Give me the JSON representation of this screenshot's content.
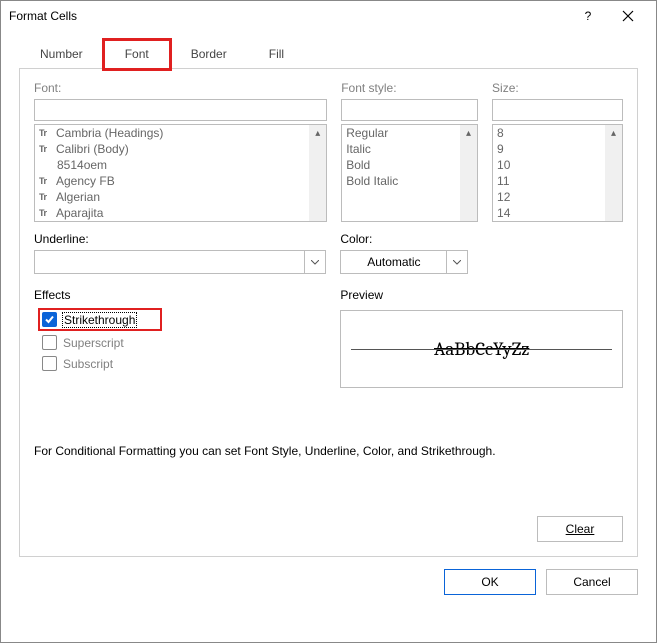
{
  "window": {
    "title": "Format Cells",
    "help": "?",
    "close": "×"
  },
  "tabs": {
    "number": "Number",
    "font": "Font",
    "border": "Border",
    "fill": "Fill",
    "active": "font"
  },
  "labels": {
    "font": "Font:",
    "style": "Font style:",
    "size": "Size:",
    "underline": "Underline:",
    "color": "Color:",
    "effects": "Effects",
    "preview": "Preview"
  },
  "font": {
    "value": "",
    "items": [
      "Cambria (Headings)",
      "Calibri (Body)",
      "8514oem",
      "Agency FB",
      "Algerian",
      "Aparajita"
    ]
  },
  "style": {
    "value": "",
    "items": [
      "Regular",
      "Italic",
      "Bold",
      "Bold Italic"
    ]
  },
  "size": {
    "value": "",
    "items": [
      "8",
      "9",
      "10",
      "11",
      "12",
      "14"
    ]
  },
  "underline": {
    "value": ""
  },
  "color": {
    "value": "Automatic"
  },
  "effects": {
    "strikethrough": {
      "label": "Strikethrough",
      "checked": true
    },
    "superscript": {
      "label": "Superscript",
      "checked": false
    },
    "subscript": {
      "label": "Subscript",
      "checked": false
    }
  },
  "preview": {
    "text": "AaBbCcYyZz"
  },
  "note": "For Conditional Formatting you can set Font Style, Underline, Color, and Strikethrough.",
  "buttons": {
    "clear": "Clear",
    "ok": "OK",
    "cancel": "Cancel"
  }
}
